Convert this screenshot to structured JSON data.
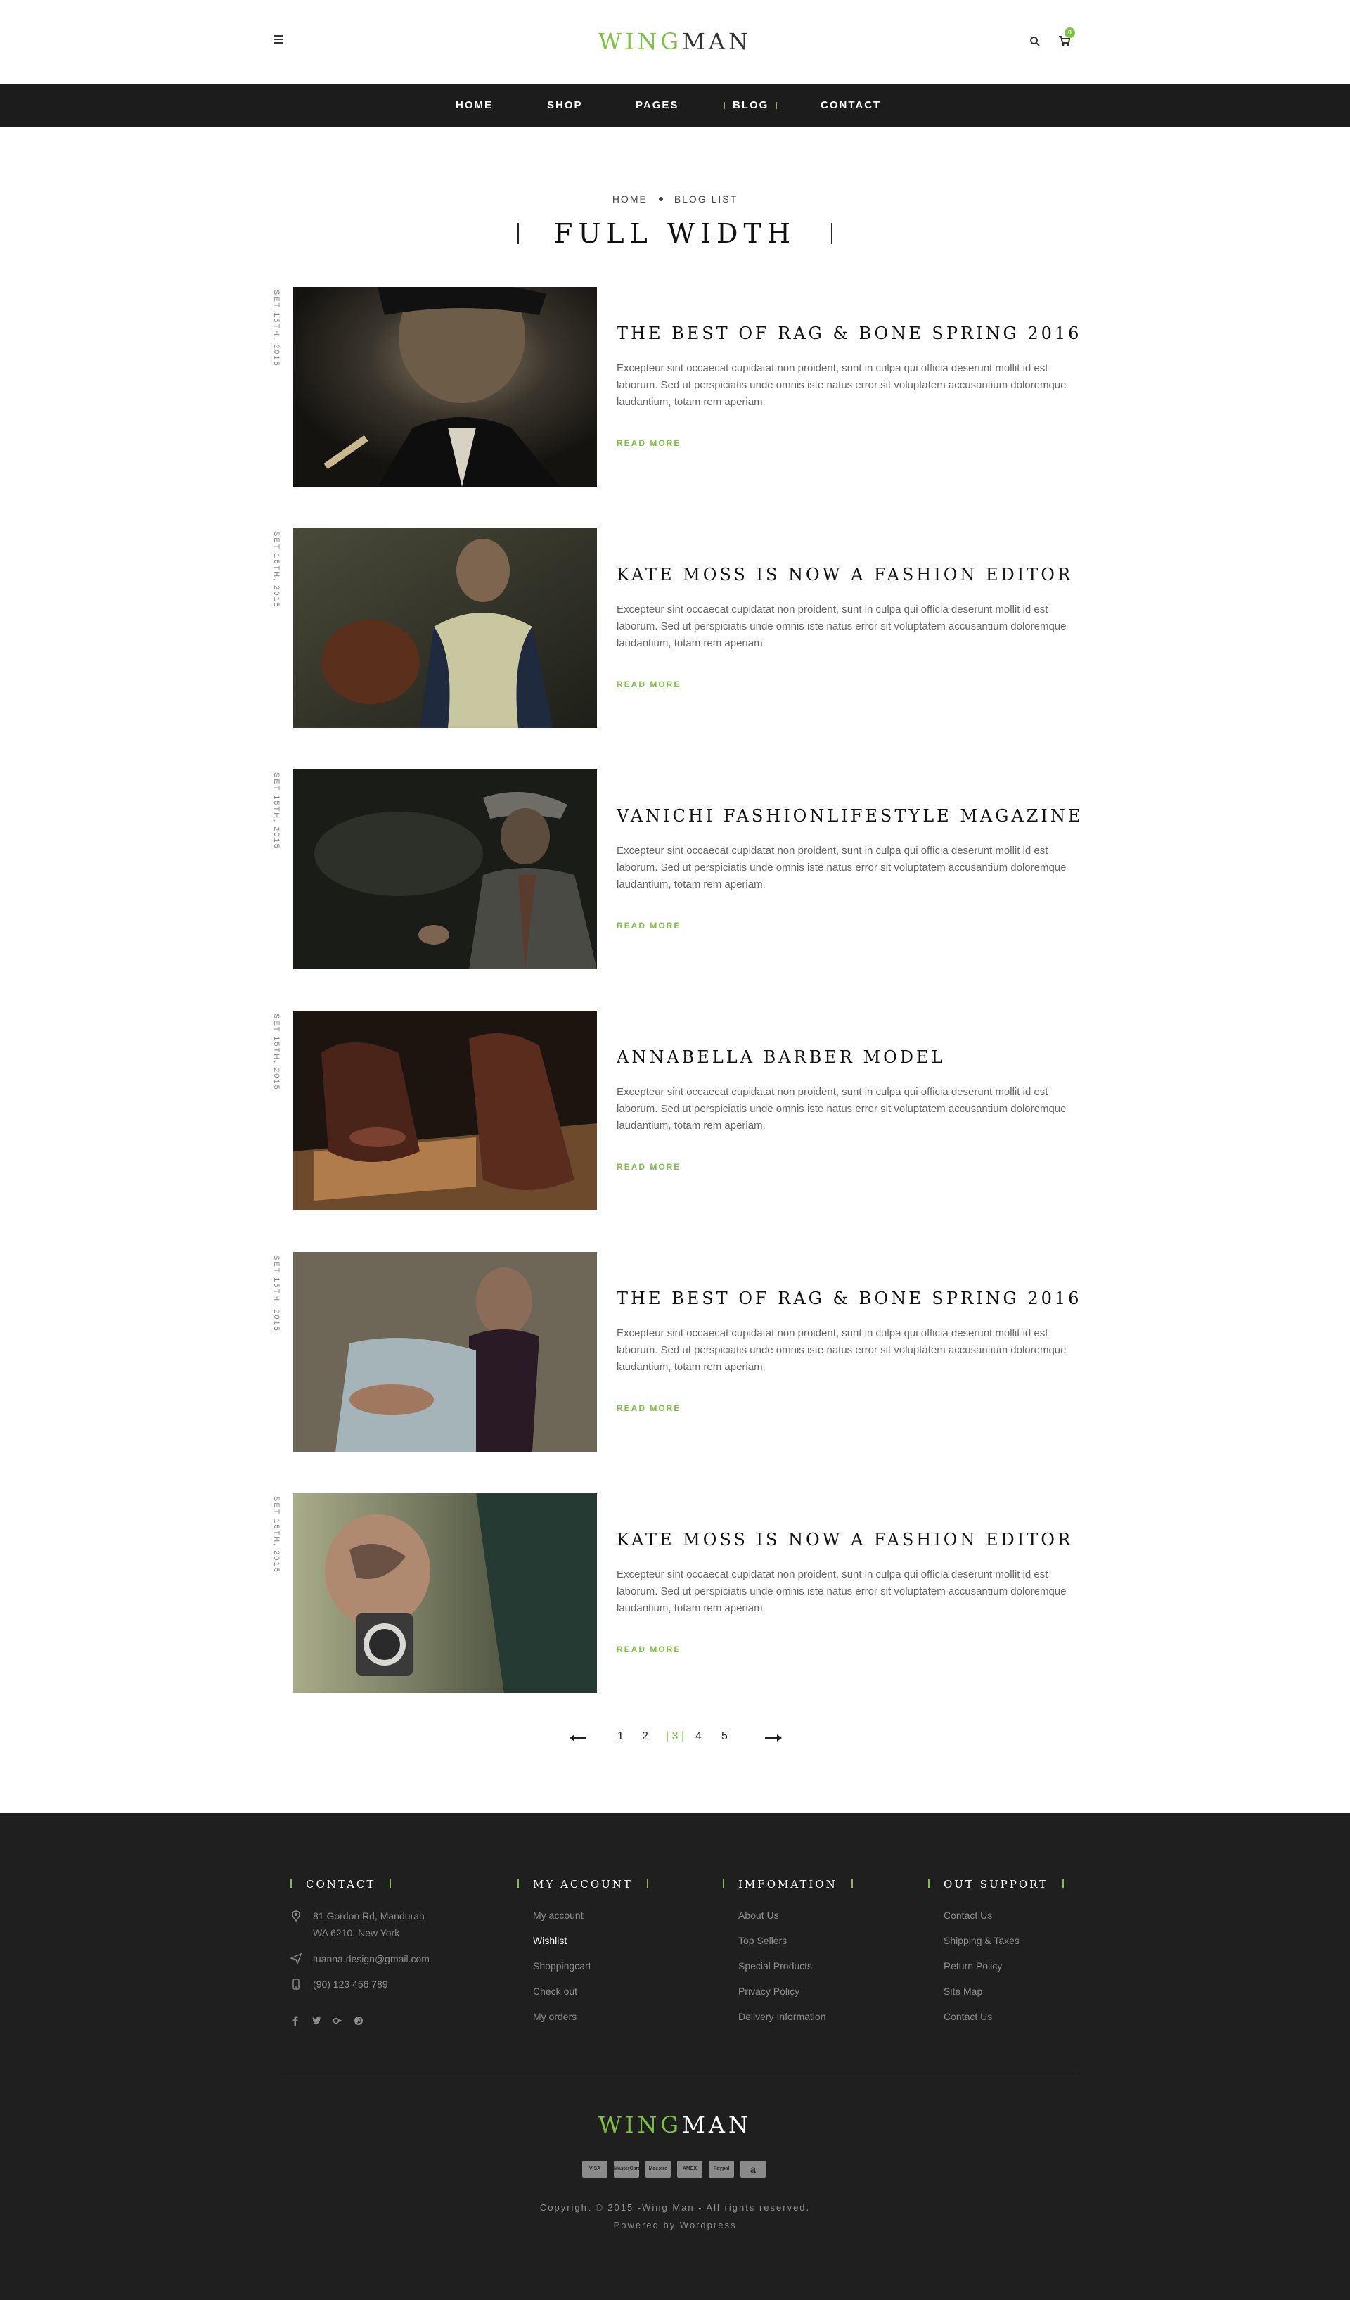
{
  "header": {
    "logo": {
      "wing": "WING",
      "man": "MAN"
    },
    "cart_count": "0"
  },
  "nav": {
    "items": [
      "HOME",
      "SHOP",
      "PAGES",
      "BLOG",
      "CONTACT"
    ]
  },
  "breadcrumb": {
    "home": "HOME",
    "current": "BLOG LIST"
  },
  "page_title": "FULL WIDTH",
  "posts": [
    {
      "date": "SET 15TH, 2015",
      "title": "THE BEST OF RAG & BONE SPRING 2016",
      "excerpt": "Excepteur sint occaecat cupidatat non proident, sunt in culpa qui officia deserunt mollit id est laborum. Sed ut perspiciatis unde omnis iste natus error sit voluptatem accusantium doloremque laudantium, totam rem aperiam.",
      "read_more": "READ MORE"
    },
    {
      "date": "SET 15TH, 2015",
      "title": "KATE MOSS IS NOW A FASHION EDITOR",
      "excerpt": "Excepteur sint occaecat cupidatat non proident, sunt in culpa qui officia deserunt mollit id est laborum. Sed ut perspiciatis unde omnis iste natus error sit voluptatem accusantium doloremque laudantium, totam rem aperiam.",
      "read_more": "READ MORE"
    },
    {
      "date": "SET 15TH, 2015",
      "title": "VANICHI FASHIONLIFESTYLE MAGAZINE",
      "excerpt": "Excepteur sint occaecat cupidatat non proident, sunt in culpa qui officia deserunt mollit id est laborum. Sed ut perspiciatis unde omnis iste natus error sit voluptatem accusantium doloremque laudantium, totam rem aperiam.",
      "read_more": "READ MORE"
    },
    {
      "date": "SET 15TH, 2015",
      "title": "ANNABELLA BARBER MODEL",
      "excerpt": "Excepteur sint occaecat cupidatat non proident, sunt in culpa qui officia deserunt mollit id est laborum. Sed ut perspiciatis unde omnis iste natus error sit voluptatem accusantium doloremque laudantium, totam rem aperiam.",
      "read_more": "READ MORE"
    },
    {
      "date": "SET 15TH, 2015",
      "title": "THE BEST OF RAG & BONE SPRING 2016",
      "excerpt": "Excepteur sint occaecat cupidatat non proident, sunt in culpa qui officia deserunt mollit id est laborum. Sed ut perspiciatis unde omnis iste natus error sit voluptatem accusantium doloremque laudantium, totam rem aperiam.",
      "read_more": "READ MORE"
    },
    {
      "date": "SET 15TH, 2015",
      "title": "KATE MOSS IS NOW A FASHION EDITOR",
      "excerpt": "Excepteur sint occaecat cupidatat non proident, sunt in culpa qui officia deserunt mollit id est laborum. Sed ut perspiciatis unde omnis iste natus error sit voluptatem accusantium doloremque laudantium, totam rem aperiam.",
      "read_more": "READ MORE"
    }
  ],
  "pagination": {
    "pages": [
      "1",
      "2",
      "3",
      "4",
      "5"
    ],
    "current": "3"
  },
  "footer": {
    "contact": {
      "heading": "CONTACT",
      "address_line1": "81 Gordon Rd, Mandurah",
      "address_line2": "WA 6210, New York",
      "email": "tuanna.design@gmail.com",
      "phone": "(90) 123 456 789"
    },
    "my_account": {
      "heading": "MY ACCOUNT",
      "links": [
        "My account",
        "Wishlist",
        "Shoppingcart",
        "Check out",
        "My orders"
      ]
    },
    "information": {
      "heading": "IMFOMATION",
      "links": [
        "About Us",
        "Top Sellers",
        "Special Products",
        "Privacy Policy",
        "Delivery Information"
      ]
    },
    "support": {
      "heading": "OUT SUPPORT",
      "links": [
        "Contact Us",
        "Shipping & Taxes",
        "Return Policy",
        "Site Map",
        "Contact Us"
      ]
    },
    "logo": {
      "wing": "WING",
      "man": "MAN"
    },
    "payments": [
      "VISA",
      "MasterCard",
      "Maestro",
      "AMEX",
      "Paypal",
      "a"
    ],
    "copyright": "Copyright © 2015 -Wing Man - All rights reserved.",
    "powered": "Powered by Wordpress"
  },
  "colors": {
    "accent": "#7dc242",
    "nav_bg": "#1c1c1c",
    "footer_bg": "#1f1f1f"
  },
  "icons": [
    "menu-icon",
    "search-icon",
    "cart-icon",
    "map-pin-icon",
    "send-icon",
    "phone-icon",
    "facebook-icon",
    "twitter-icon",
    "google-plus-icon",
    "pinterest-icon"
  ]
}
